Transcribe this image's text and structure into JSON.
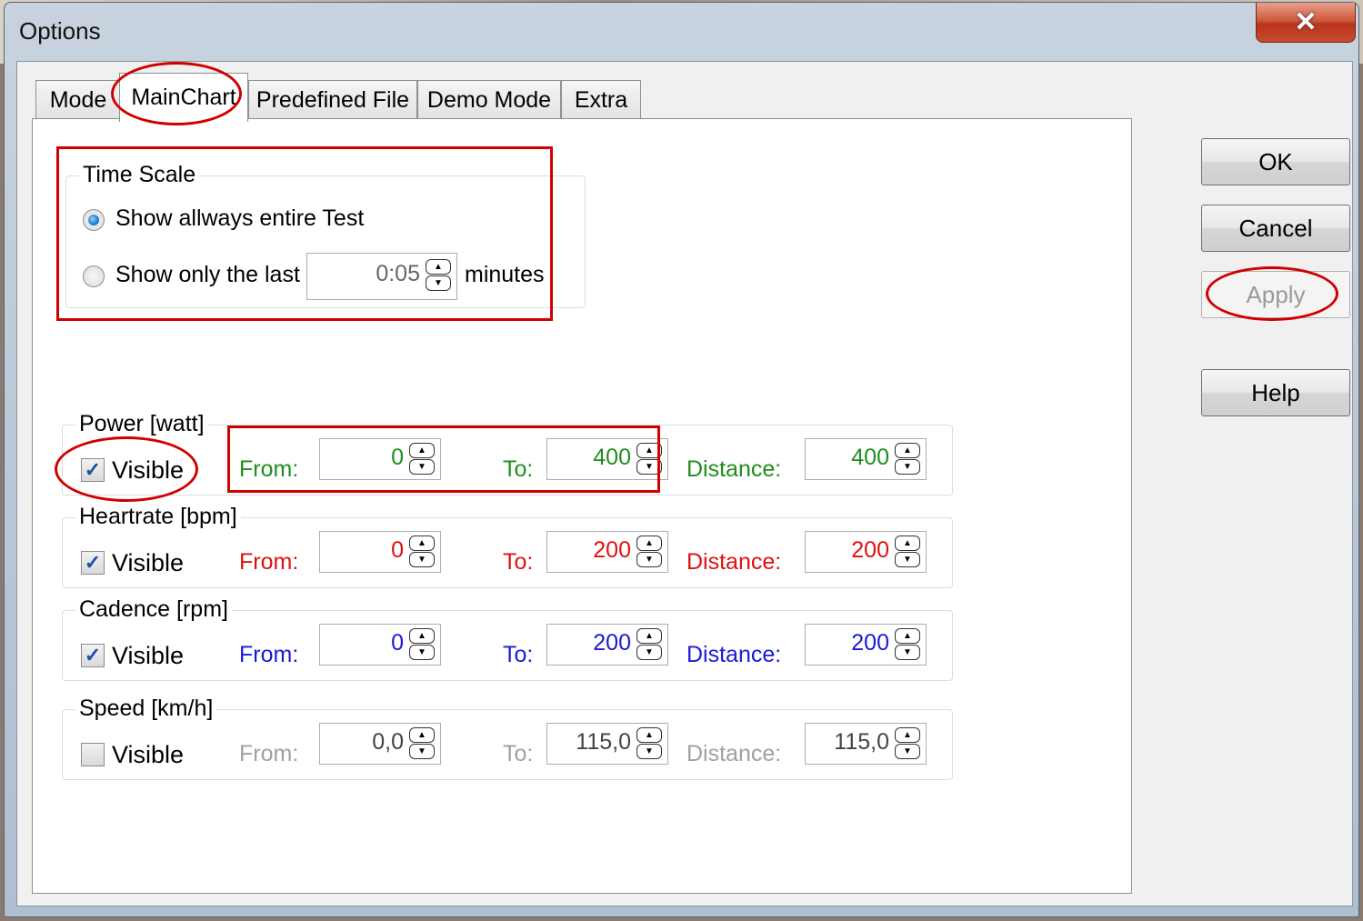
{
  "window": {
    "title": "Options",
    "close_glyph": "✕"
  },
  "tabs": [
    {
      "label": "Mode"
    },
    {
      "label": "MainChart",
      "active": true
    },
    {
      "label": "Predefined File"
    },
    {
      "label": "Demo Mode"
    },
    {
      "label": "Extra"
    }
  ],
  "time_scale": {
    "title": "Time Scale",
    "option_entire": "Show allways entire Test",
    "option_last": "Show only the last",
    "selected": "entire",
    "last_value": "0:05",
    "unit": "minutes"
  },
  "labels": {
    "visible": "Visible",
    "from": "From:",
    "to": "To:",
    "distance": "Distance:"
  },
  "channels": [
    {
      "title": "Power [watt]",
      "visible": true,
      "from": "0",
      "to": "400",
      "distance": "400",
      "color": "#1e8f1e"
    },
    {
      "title": "Heartrate [bpm]",
      "visible": true,
      "from": "0",
      "to": "200",
      "distance": "200",
      "color": "#e01010"
    },
    {
      "title": "Cadence [rpm]",
      "visible": true,
      "from": "0",
      "to": "200",
      "distance": "200",
      "color": "#1a1ad8"
    },
    {
      "title": "Speed [km/h]",
      "visible": false,
      "from": "0,0",
      "to": "115,0",
      "distance": "115,0",
      "color": "#a0a0a0",
      "value_color": "#444444"
    }
  ],
  "buttons": {
    "ok": "OK",
    "cancel": "Cancel",
    "apply": "Apply",
    "help": "Help"
  },
  "icons": {
    "spin_up": "▲",
    "spin_down": "▼",
    "check": "✓"
  }
}
